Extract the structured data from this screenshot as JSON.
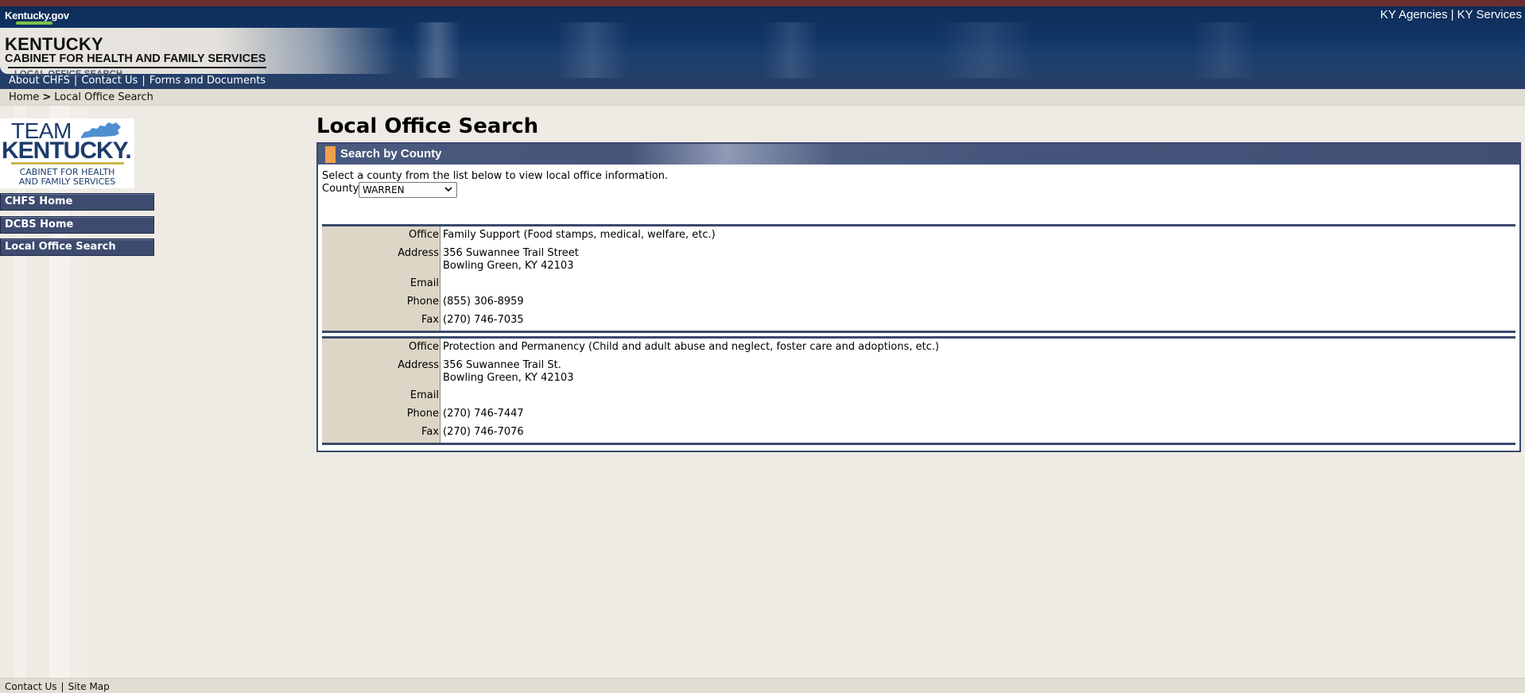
{
  "header": {
    "gov_logo": "Kentucky.gov",
    "top_links": [
      "KY Agencies",
      "KY Services"
    ],
    "top_links_sep": "|",
    "brand_line1": "KENTUCKY",
    "brand_line2": "CABINET FOR HEALTH AND FAMILY SERVICES",
    "brand_line3": "LOCAL OFFICE SEARCH",
    "subnav": [
      "About CHFS",
      "Contact Us",
      "Forms and Documents"
    ],
    "subnav_sep": "|"
  },
  "breadcrumb": {
    "home": "Home",
    "sep": ">",
    "current": "Local Office Search"
  },
  "sidebar": {
    "logo": {
      "team": "TEAM",
      "kentucky": "KENTUCKY.",
      "cabinet_line1": "CABINET FOR HEALTH",
      "cabinet_line2": "AND FAMILY SERVICES"
    },
    "nav": [
      "CHFS Home",
      "DCBS Home",
      "Local Office Search"
    ]
  },
  "main": {
    "title": "Local Office Search",
    "panel_title": "Search by County",
    "instructions": "Select a county from the list below to view local office information.",
    "county_label": "County",
    "county_selected": "WARREN",
    "field_labels": {
      "office": "Office",
      "address": "Address",
      "email": "Email",
      "phone": "Phone",
      "fax": "Fax"
    },
    "offices": [
      {
        "office": "Family Support (Food stamps, medical, welfare, etc.)",
        "address_line1": "356 Suwannee Trail Street",
        "address_line2": "Bowling Green, KY  42103",
        "email": "",
        "phone": "(855) 306-8959",
        "fax": "(270) 746-7035"
      },
      {
        "office": "Protection and Permanency (Child and adult abuse and neglect, foster care and adoptions, etc.)",
        "address_line1": "356 Suwannee Trail St.",
        "address_line2": "Bowling Green, KY  42103",
        "email": "",
        "phone": "(270) 746-7447",
        "fax": "(270) 746-7076"
      }
    ]
  },
  "footer": {
    "links": [
      "Contact Us",
      "Site Map"
    ],
    "sep": "|"
  },
  "colors": {
    "nav_blue": "#3d4b6f",
    "header_navy": "#123667",
    "accent_orange": "#f0a04c",
    "label_tan": "#ddd6c7",
    "background": "#eeeae4"
  }
}
